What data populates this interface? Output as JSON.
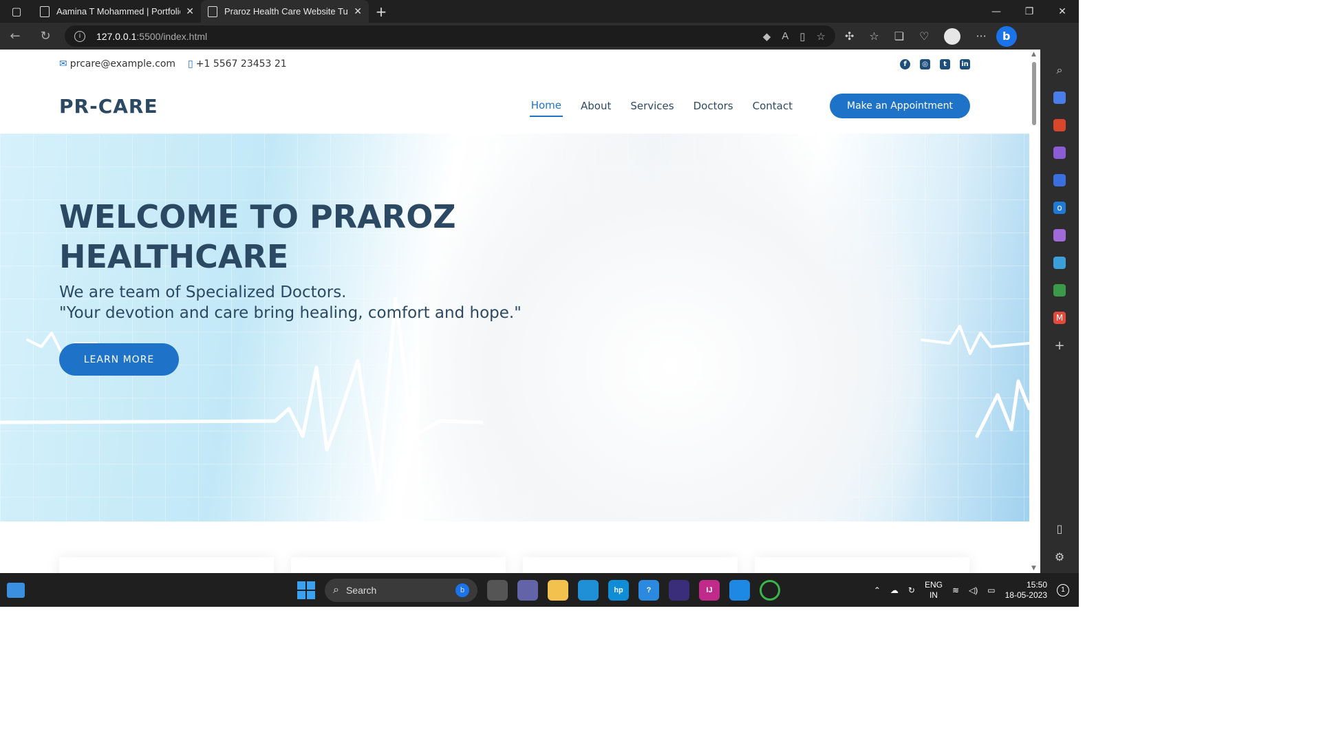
{
  "browser": {
    "tabs": [
      {
        "title": "Aamina T Mohammed | Portfolio",
        "active": false
      },
      {
        "title": "Praroz Health Care Website Tuto",
        "active": true
      }
    ],
    "url_host": "127.0.0.1",
    "url_path": ":5500/index.html"
  },
  "site": {
    "email": "prcare@example.com",
    "phone": "+1 5567 23453 21",
    "logo": "PR-CARE",
    "nav": [
      "Home",
      "About",
      "Services",
      "Doctors",
      "Contact"
    ],
    "active_nav": "Home",
    "appointment_button": "Make an Appointment",
    "hero": {
      "title_line1": "WELCOME TO PRAROZ",
      "title_line2": "HEALTHCARE",
      "subtitle_line1": "We are team of Specialized Doctors.",
      "subtitle_line2": "\"Your devotion and care bring healing, comfort and hope.\"",
      "button": "LEARN MORE"
    },
    "accent_color": "#1e73c8",
    "heading_color": "#2c4964"
  },
  "taskbar": {
    "search_placeholder": "Search",
    "lang_line1": "ENG",
    "lang_line2": "IN",
    "time": "15:50",
    "date": "18-05-2023",
    "notifications": "1"
  }
}
